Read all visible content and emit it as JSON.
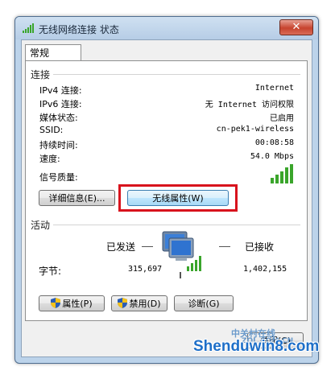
{
  "window": {
    "title": "无线网络连接 状态",
    "close_label": "关闭(C)"
  },
  "tab": {
    "label": "常规"
  },
  "connection": {
    "title": "连接",
    "rows": [
      {
        "label": "IPv4 连接:",
        "value": "Internet"
      },
      {
        "label": "IPv6 连接:",
        "value": "无 Internet 访问权限"
      },
      {
        "label": "媒体状态:",
        "value": "已启用"
      },
      {
        "label": "SSID:",
        "value": "cn-pek1-wireless"
      },
      {
        "label": "持续时间:",
        "value": "00:08:58"
      },
      {
        "label": "速度:",
        "value": "54.0 Mbps"
      }
    ],
    "signal_label": "信号质量:",
    "details_button": "详细信息(E)...",
    "wireless_props_button": "无线属性(W)"
  },
  "activity": {
    "title": "活动",
    "sent_label": "已发送",
    "received_label": "已接收",
    "bytes_label": "字节:",
    "bytes_sent": "315,697",
    "bytes_received": "1,402,155"
  },
  "buttons": {
    "properties": "属性(P)",
    "disable": "禁用(D)",
    "diagnose": "诊断(G)"
  },
  "watermark": {
    "logo_text": "中关村在线",
    "logo_sub": "ZOL.COM.CN",
    "site": "Shenduwin8.com"
  },
  "colors": {
    "highlight": "#d8131d",
    "signal": "#3aa52b",
    "titlebar": "#bcd3ea"
  }
}
